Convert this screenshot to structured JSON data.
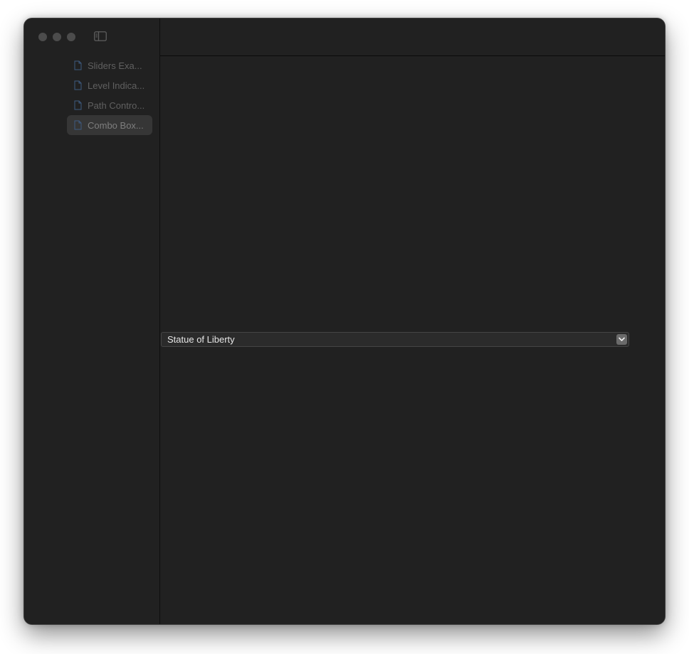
{
  "sidebar": {
    "items": [
      {
        "label": "Sliders Exa...",
        "icon": "document-icon",
        "selected": false
      },
      {
        "label": "Level Indica...",
        "icon": "document-icon",
        "selected": false
      },
      {
        "label": "Path Contro...",
        "icon": "document-icon",
        "selected": false
      },
      {
        "label": "Combo Box...",
        "icon": "document-icon",
        "selected": true
      }
    ]
  },
  "toolbar": {
    "sidebar_toggle_icon": "sidebar-toggle-icon"
  },
  "combo_box": {
    "value": "Statue of Liberty",
    "button_icon": "chevron-down-icon"
  },
  "colors": {
    "window_bg": "#212121",
    "selected_item_bg": "#363636",
    "doc_icon": "#3d5a80"
  }
}
